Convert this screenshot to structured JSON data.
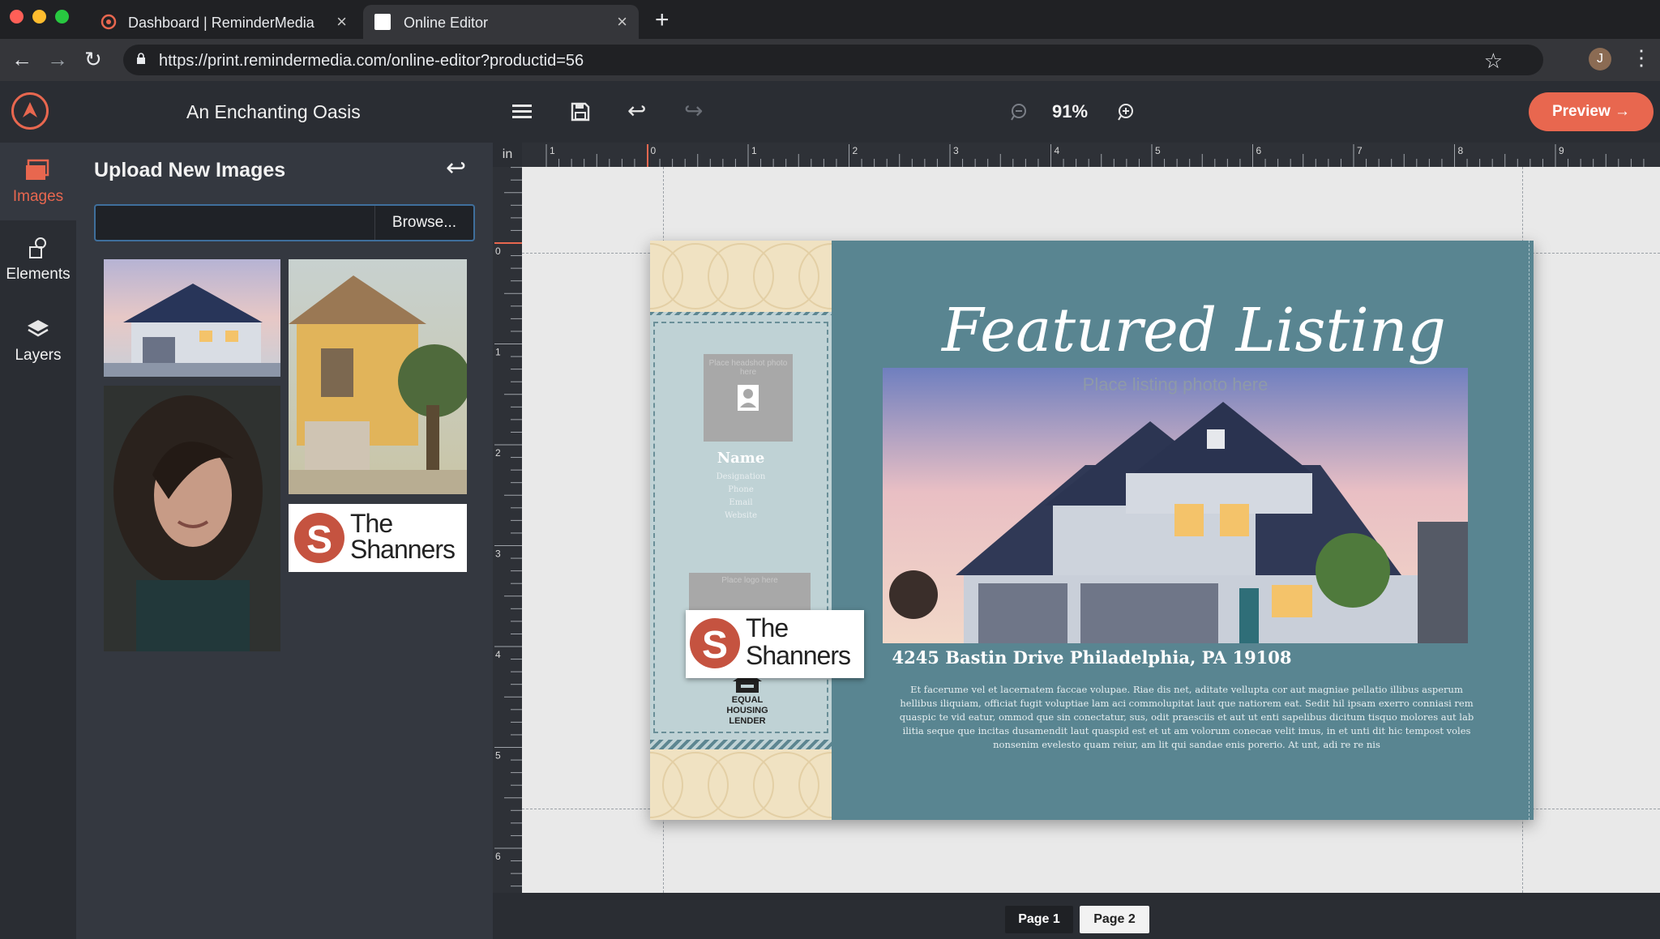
{
  "browser": {
    "tabs": [
      {
        "title": "Dashboard | ReminderMedia",
        "active": false
      },
      {
        "title": "Online Editor",
        "active": true
      }
    ],
    "url": "https://print.remindermedia.com/online-editor?productid=56",
    "profile_initial": "J",
    "traffic_colors": [
      "#ff5f57",
      "#febc2e",
      "#28c840"
    ]
  },
  "app": {
    "document_title": "An Enchanting Oasis",
    "zoom": "91%",
    "preview_label": "Preview →",
    "accent": "#e8674f",
    "rail": [
      {
        "label": "Images",
        "icon": "images-icon",
        "active": true
      },
      {
        "label": "Elements",
        "icon": "elements-icon",
        "active": false
      },
      {
        "label": "Layers",
        "icon": "layers-icon",
        "active": false
      }
    ],
    "panel": {
      "title": "Upload New Images",
      "browse_label": "Browse...",
      "logo_text_line1": "The",
      "logo_text_line2": "Shanners"
    },
    "ruler_unit": "in",
    "ruler_top_labels": [
      "1",
      "0",
      "1",
      "2",
      "3",
      "4",
      "5",
      "6",
      "7",
      "8",
      "9"
    ],
    "ruler_left_labels": [
      "0",
      "1",
      "2",
      "3",
      "4",
      "5",
      "6"
    ],
    "pages": [
      "Page 1",
      "Page 2"
    ]
  },
  "card": {
    "headline": "Featured Listing",
    "listing_placeholder": "Place listing photo here",
    "headshot_placeholder": "Place headshot photo here",
    "agent_name": "Name",
    "agent_details": [
      "Designation",
      "Phone",
      "Email",
      "Website"
    ],
    "logo_placeholder": "Place logo here",
    "equal_housing": "EQUAL HOUSING LENDER",
    "address": "4245 Bastin Drive Philadelphia, PA 19108",
    "body": "Et facerume vel et lacernatem faccae volupae. Riae dis net, aditate vellupta cor aut magniae pellatio illibus asperum hellibus iliquiam, officiat fugit voluptiae lam aci commolupitat laut que natiorem eat. Sedit hil ipsam exerro conniasi rem quaspic te vid eatur, ommod que sin conectatur, sus, odit praesciis et aut ut enti sapelibus dicitum tisquo molores aut lab ilitia seque que incitas dusamendit laut quaspid est et ut am volorum conecae velit imus, in et unti dit hic tempost voles nonsenim evelesto quam reiur, am lit qui sandae enis porerio. At unt, adi re re nis",
    "colors": {
      "teal": "#598591",
      "cream": "#f0e2c2",
      "light_teal": "#bfd2d5"
    }
  }
}
